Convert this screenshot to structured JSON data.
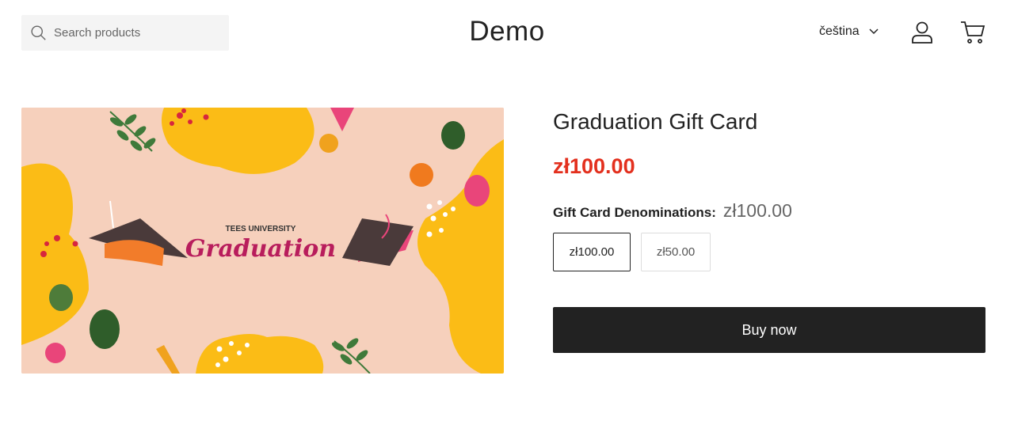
{
  "header": {
    "search": {
      "placeholder": "Search products",
      "value": ""
    },
    "store_name": "Demo",
    "language": "čeština"
  },
  "product": {
    "image_text": {
      "line1": "TEES UNIVERSITY",
      "line2": "Graduation"
    },
    "title": "Graduation Gift Card",
    "price": "zł100.00",
    "denominations": {
      "label": "Gift Card Denominations:",
      "selected_value": "zł100.00",
      "options": [
        "zł100.00",
        "zł50.00"
      ]
    },
    "buy_label": "Buy now"
  },
  "colors": {
    "price": "#e3301e",
    "button_bg": "#222222",
    "hero_bg": "#f6d0bc",
    "hero_yellow": "#fbbc16"
  }
}
